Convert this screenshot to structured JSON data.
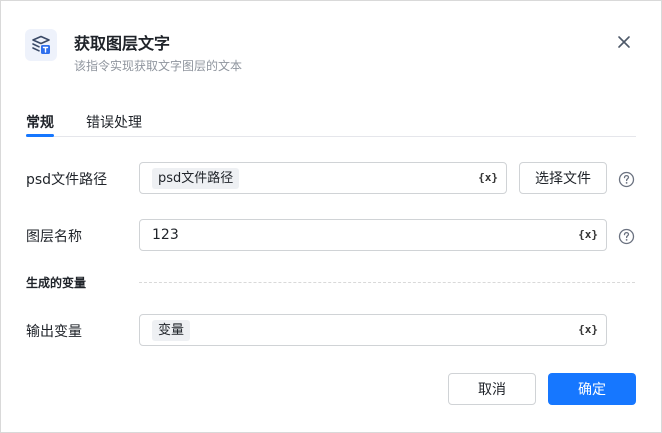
{
  "dialog": {
    "title": "获取图层文字",
    "subtitle": "该指令实现获取文字图层的文本"
  },
  "tabs": [
    {
      "label": "常规",
      "active": true
    },
    {
      "label": "错误处理",
      "active": false
    }
  ],
  "form": {
    "psd_path": {
      "label": "psd文件路径",
      "chip": "psd文件路径",
      "var_symbol": "{x}",
      "select_file_label": "选择文件"
    },
    "layer_name": {
      "label": "图层名称",
      "value": "123",
      "var_symbol": "{x}"
    },
    "section_generated": "生成的变量",
    "output_var": {
      "label": "输出变量",
      "chip": "变量",
      "var_symbol": "{x}"
    }
  },
  "footer": {
    "cancel_label": "取消",
    "ok_label": "确定"
  },
  "colors": {
    "accent": "#1677ff",
    "border": "#d0d3d6",
    "muted_text": "#8f959e",
    "chip_bg": "#eef0f3"
  },
  "icons": {
    "app": "layer-text-icon",
    "close": "close-icon",
    "help": "help-circle-icon"
  }
}
